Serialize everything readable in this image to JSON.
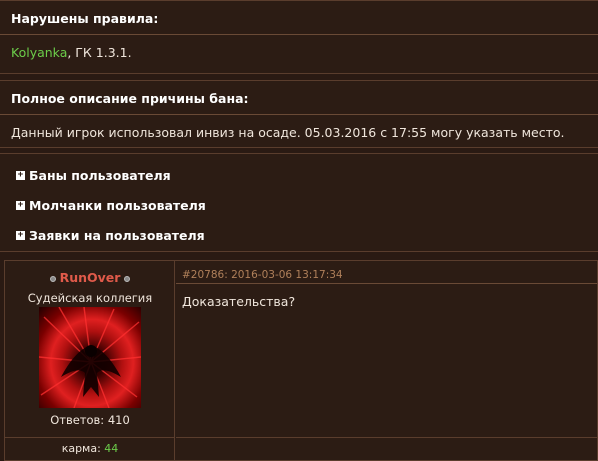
{
  "violation": {
    "heading": "Нарушены правила:",
    "user": "Kolyanka",
    "rule": ", ГК 1.3.1."
  },
  "reason": {
    "heading": "Полное описание причины бана:",
    "text": "Данный игрок использовал инвиз на осаде. 05.03.2016 с 17:55 могу указать место."
  },
  "toggles": [
    {
      "label": "Баны пользователя"
    },
    {
      "label": "Молчанки пользователя"
    },
    {
      "label": "Заявки на пользователя"
    }
  ],
  "post": {
    "author": "RunOver",
    "author_title": "Судейская коллегия",
    "replies_label": "Ответов: 410",
    "karma_label": "карма: ",
    "karma_value": "44",
    "meta": "#20786: 2016-03-06 13:17:34",
    "text": "Доказательства?"
  },
  "colors": {
    "background": "#2c1c14",
    "border": "#5a3d2d",
    "username_green": "#6ccd4a",
    "author_red": "#e05a4a",
    "meta_brown": "#b0805a"
  },
  "icons": [
    "plus-box-icon",
    "status-dot-icon"
  ]
}
